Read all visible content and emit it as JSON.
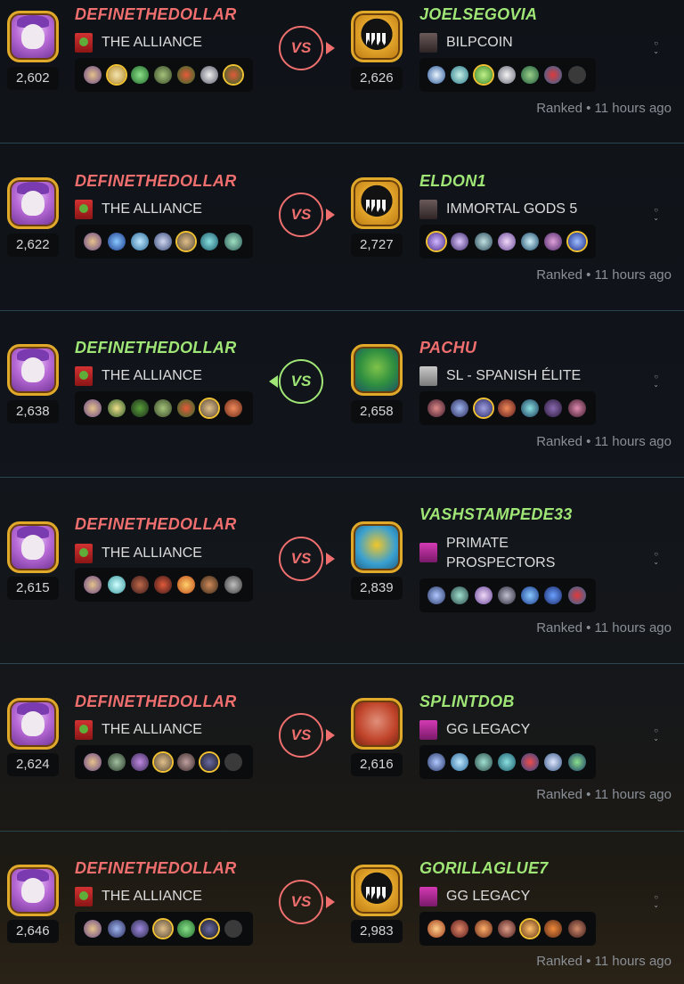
{
  "battles": [
    {
      "player": {
        "name": "DEFINETHEDOLLAR",
        "guild": "THE ALLIANCE",
        "rating": "2,602",
        "result": "loss"
      },
      "opponent": {
        "name": "JOELSEGOVIA",
        "guild": "BILPCOIN",
        "rating": "2,626",
        "result": "win"
      },
      "vs_label": "VS",
      "match_type": "Ranked",
      "time": "11 hours ago"
    },
    {
      "player": {
        "name": "DEFINETHEDOLLAR",
        "guild": "THE ALLIANCE",
        "rating": "2,622",
        "result": "loss"
      },
      "opponent": {
        "name": "ELDON1",
        "guild": "IMMORTAL GODS 5",
        "rating": "2,727",
        "result": "win"
      },
      "vs_label": "VS",
      "match_type": "Ranked",
      "time": "11 hours ago"
    },
    {
      "player": {
        "name": "DEFINETHEDOLLAR",
        "guild": "THE ALLIANCE",
        "rating": "2,638",
        "result": "win"
      },
      "opponent": {
        "name": "PACHU",
        "guild": "SL - SPANISH ÉLITE",
        "rating": "2,658",
        "result": "loss"
      },
      "vs_label": "VS",
      "match_type": "Ranked",
      "time": "11 hours ago"
    },
    {
      "player": {
        "name": "DEFINETHEDOLLAR",
        "guild": "THE ALLIANCE",
        "rating": "2,615",
        "result": "loss"
      },
      "opponent": {
        "name": "VASHSTAMPEDE33",
        "guild_line1": "PRIMATE",
        "guild_line2": "PROSPECTORS",
        "rating": "2,839",
        "result": "win"
      },
      "vs_label": "VS",
      "match_type": "Ranked",
      "time": "11 hours ago"
    },
    {
      "player": {
        "name": "DEFINETHEDOLLAR",
        "guild": "THE ALLIANCE",
        "rating": "2,624",
        "result": "loss"
      },
      "opponent": {
        "name": "SPLINTDOB",
        "guild": "GG LEGACY",
        "rating": "2,616",
        "result": "win"
      },
      "vs_label": "VS",
      "match_type": "Ranked",
      "time": "11 hours ago"
    },
    {
      "player": {
        "name": "DEFINETHEDOLLAR",
        "guild": "THE ALLIANCE",
        "rating": "2,646",
        "result": "loss"
      },
      "opponent": {
        "name": "GORILLAGLUE7",
        "guild": "GG LEGACY",
        "rating": "2,983",
        "result": "win"
      },
      "vs_label": "VS",
      "match_type": "Ranked",
      "time": "11 hours ago"
    }
  ],
  "separator": "•",
  "colors": {
    "win": "#9fe676",
    "loss": "#ef6f6f",
    "divider": "#2a4450"
  }
}
